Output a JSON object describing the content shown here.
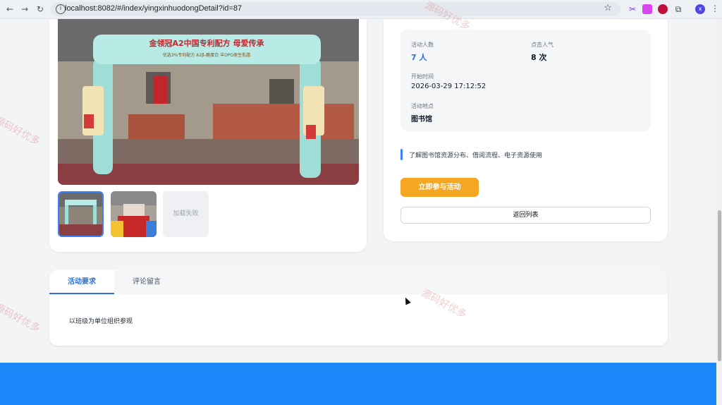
{
  "browser": {
    "url": "localhost:8082/#/index/yingxinhuodongDetail?id=87",
    "profile_initial": "x"
  },
  "photo": {
    "banner_text": "金领冠A2中国专利配方 母爱传承",
    "banner_sub": "优选3%专利配方 A2β-酪蛋白 羊OPO原生乳脂"
  },
  "thumbnails": {
    "failed_label": "加载失败"
  },
  "stats": {
    "participants_label": "活动人数",
    "participants_value": "7 人",
    "views_label": "点击人气",
    "views_value": "8 次",
    "start_time_label": "开始时间",
    "start_time_value": "2026-03-29 17:12:52",
    "location_label": "活动地点",
    "location_value": "图书馆"
  },
  "description": "了解图书馆资源分布、借阅流程、电子资源使用",
  "buttons": {
    "join": "立即参与活动",
    "back": "返回列表"
  },
  "tabs": [
    {
      "label": "活动要求",
      "active": true
    },
    {
      "label": "评论留言",
      "active": false
    }
  ],
  "tab_content": "以班级为单位组织参观",
  "watermark": "源码好优多",
  "colors": {
    "accent": "#2f6fd6",
    "join_button": "#f5a623",
    "footer": "#1a86f7"
  }
}
